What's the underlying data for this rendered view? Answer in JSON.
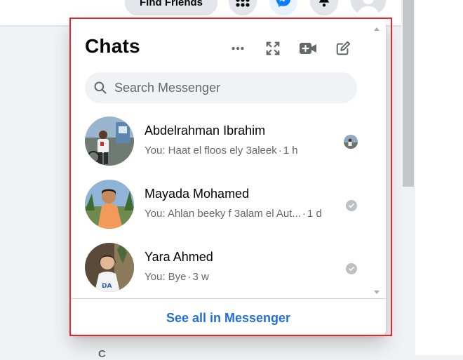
{
  "topbar": {
    "find_friends_label": "Find Friends",
    "icons": [
      "menu-grid-icon",
      "messenger-icon",
      "notifications-bell-icon",
      "account-avatar"
    ]
  },
  "background": {
    "partial_text": "C"
  },
  "chats_panel": {
    "title": "Chats",
    "header_icons": [
      "more-options-icon",
      "expand-icon",
      "new-room-video-icon",
      "new-message-icon"
    ],
    "search": {
      "placeholder": "Search Messenger",
      "value": ""
    },
    "conversations": [
      {
        "name": "Abdelrahman Ibrahim",
        "preview": "You: Haat el floos ely 3aleek",
        "separator": "·",
        "time": "1 h",
        "status": "seen-avatar"
      },
      {
        "name": "Mayada Mohamed",
        "preview": "You: Ahlan beeky f 3alam el Aut...",
        "separator": "·",
        "time": "1 d",
        "status": "delivered-check"
      },
      {
        "name": "Yara Ahmed",
        "preview": "You: Bye",
        "separator": "·",
        "time": "3 w",
        "status": "delivered-check"
      }
    ],
    "footer_link": "See all in Messenger"
  },
  "colors": {
    "accent": "#216fdb",
    "messenger_blue": "#0a7cff",
    "highlight_border": "#e0282d",
    "secondary_text": "#65676b"
  }
}
